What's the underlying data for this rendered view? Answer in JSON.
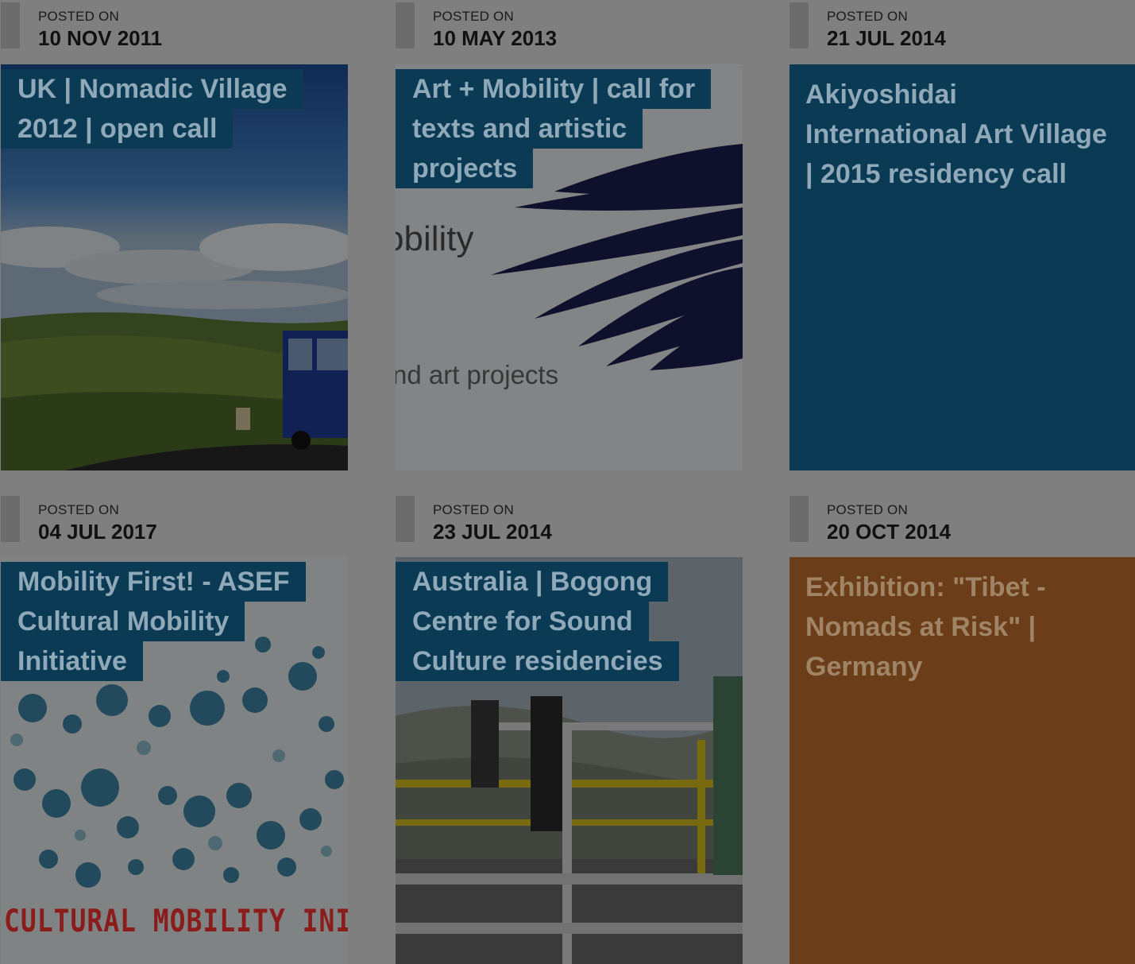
{
  "posts": [
    {
      "posted_label": "POSTED ON",
      "date": "10 NOV 2011",
      "title": "UK | Nomadic Village 2012 | open call"
    },
    {
      "posted_label": "POSTED ON",
      "date": "10 MAY 2013",
      "title": "Art + Mobility | call for texts and artistic projects",
      "image_text": [
        "obility",
        "nd art projects"
      ]
    },
    {
      "posted_label": "POSTED ON",
      "date": "21 JUL 2014",
      "title": "Akiyoshidai International Art Village | 2015 residency call",
      "tile_color": "#0b3a55"
    },
    {
      "posted_label": "POSTED ON",
      "date": "04 JUL 2017",
      "title": "Mobility First! - ASEF Cultural Mobility Initiative",
      "image_text": [
        "CULTURAL MOBILITY INITIA"
      ]
    },
    {
      "posted_label": "POSTED ON",
      "date": "23 JUL 2014",
      "title": "Australia | Bogong Centre for Sound Culture residencies"
    },
    {
      "posted_label": "POSTED ON",
      "date": "20 OCT 2014",
      "title": "Exhibition: \"Tibet - Nomads at Risk\" | Germany",
      "tile_color": "#6b3d18"
    }
  ],
  "colors": {
    "page_overlay": "#7f7f7f",
    "title_background": "#0b3a55",
    "title_text": "#8fa9b8",
    "orange_tile": "#6b3d18",
    "orange_tile_text": "#a08466"
  }
}
